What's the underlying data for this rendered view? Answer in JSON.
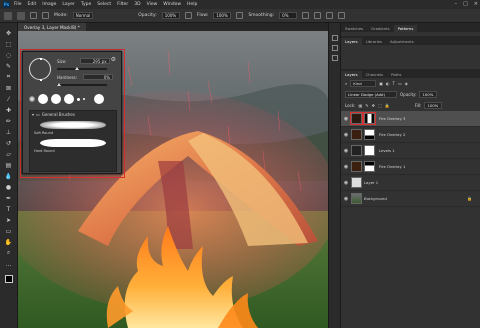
{
  "menu": {
    "logo": "Ps",
    "items": [
      "File",
      "Edit",
      "Image",
      "Layer",
      "Type",
      "Select",
      "Filter",
      "3D",
      "View",
      "Window",
      "Help"
    ]
  },
  "options_bar": {
    "mode_label": "Mode:",
    "mode_value": "Normal",
    "opacity_label": "Opacity:",
    "opacity_value": "100%",
    "flow_label": "Flow:",
    "flow_value": "100%",
    "smoothing_label": "Smoothing:",
    "smoothing_value": "0%"
  },
  "document_tab": {
    "title": "Overlay 3, Layer Mask/8) *"
  },
  "brush_picker": {
    "size_label": "Size:",
    "size_value": "295 px",
    "hardness_label": "Hardness:",
    "hardness_value": "0%",
    "folder_name": "General Brushes",
    "brushes": [
      {
        "name": "Soft Round"
      },
      {
        "name": "Hard Round"
      }
    ]
  },
  "panel_tabs_top": [
    "Swatches",
    "Gradients",
    "Patterns"
  ],
  "panel_tabs_second": [
    "Layers",
    "Libraries",
    "Adjustments"
  ],
  "layers_panel": {
    "tabs": [
      "Layers",
      "Channels",
      "Paths"
    ],
    "filter_kind": "Kind",
    "blend_mode": "Linear Dodge (Add)",
    "opacity_label": "Opacity:",
    "opacity_value": "100%",
    "lock_label": "Lock:",
    "fill_label": "Fill:",
    "fill_value": "100%",
    "layers": [
      {
        "name": "Fire Overlay 3",
        "selected": true
      },
      {
        "name": "Fire Overlay 2",
        "selected": false
      },
      {
        "name": "Levels 1",
        "selected": false
      },
      {
        "name": "Fire Overlay 1",
        "selected": false
      },
      {
        "name": "Layer 1",
        "selected": false
      },
      {
        "name": "Background",
        "selected": false
      }
    ]
  },
  "colors": {
    "selection_outline": "#d63030",
    "ps_blue": "#31a8ff"
  }
}
